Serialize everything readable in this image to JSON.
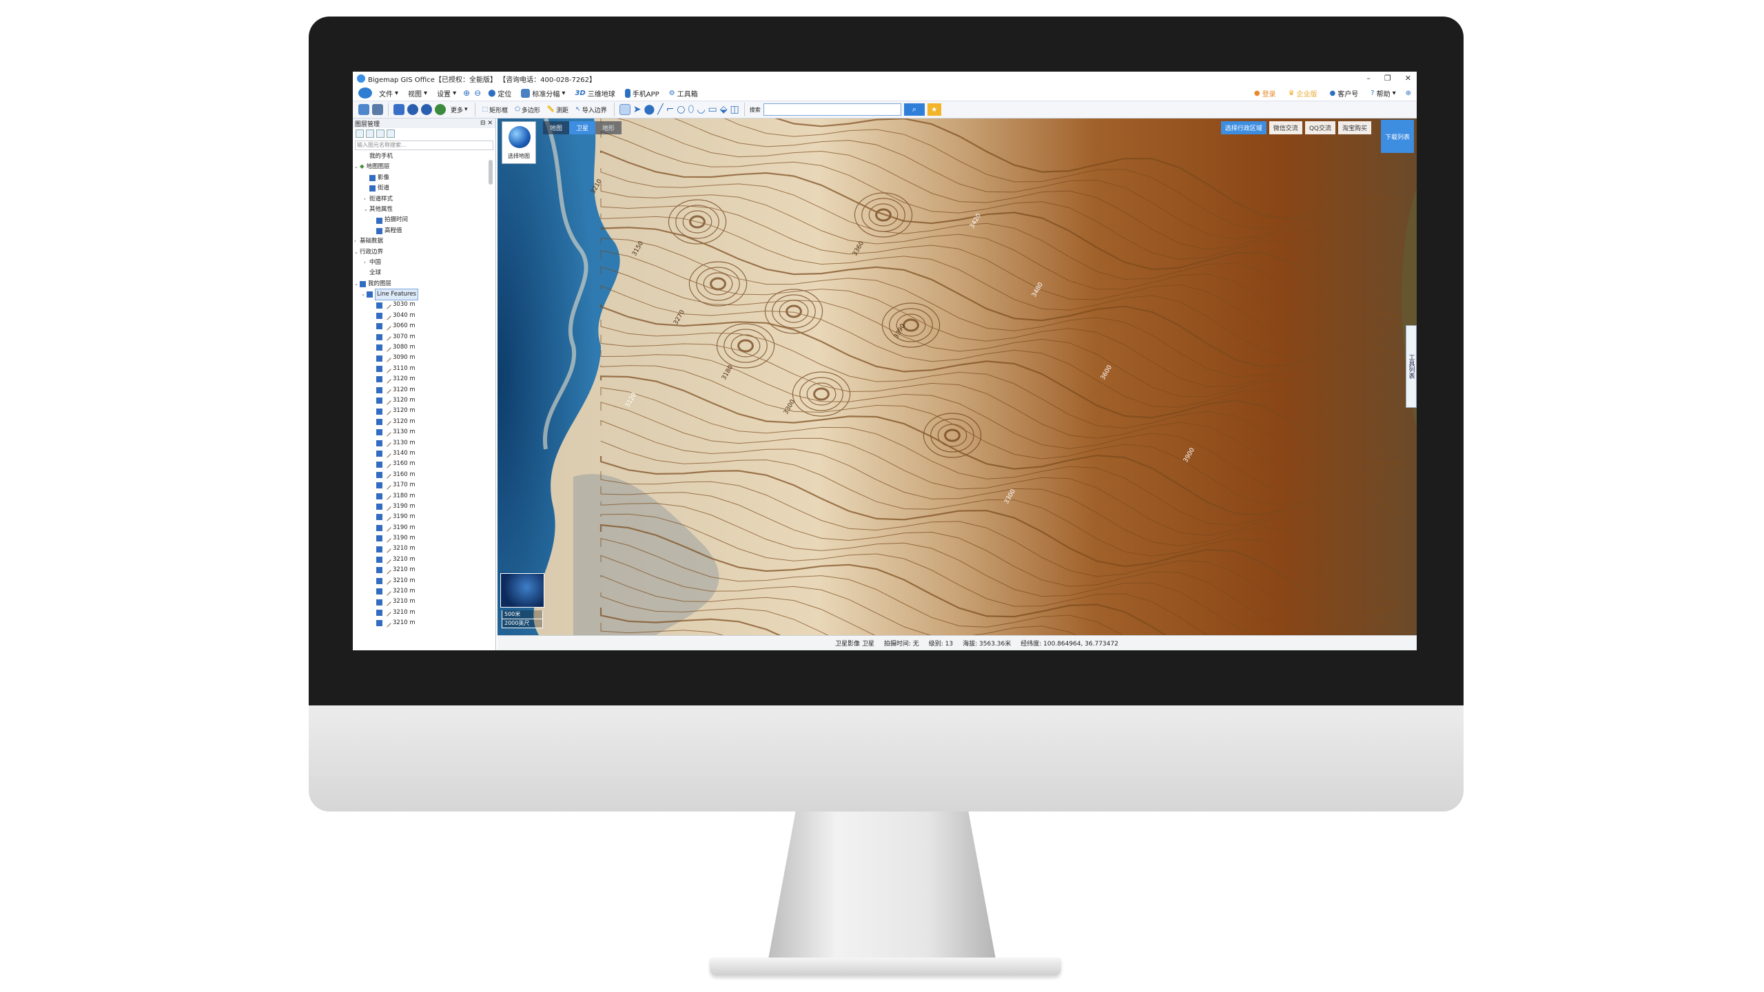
{
  "window": {
    "title": "Bigemap GIS Office【已授权：全能版】 【咨询电话：400-028-7262】"
  },
  "menubar": {
    "items": [
      "文件",
      "视图",
      "设置",
      "定位",
      "标准分幅",
      "三维地球",
      "手机APP",
      "工具箱"
    ],
    "three_d": "3D",
    "right": [
      "登录",
      "企业版",
      "客户号",
      "帮助"
    ]
  },
  "toolbar": {
    "more": "更多",
    "rect": "矩形框",
    "poly": "多边形",
    "measure": "测距",
    "import": "导入边界",
    "search_label": "搜索"
  },
  "panel": {
    "title": "图层管理",
    "search_placeholder": "输入图元名称搜索...",
    "tree": {
      "my_phone": "我的手机",
      "map_layers": "地图图层",
      "imagery": "影像",
      "roads": "街道",
      "style": "街道样式",
      "other_props": "其他属性",
      "capture_time": "拍摄时间",
      "elevation": "高程值",
      "basic_data": "基础数据",
      "admin": "行政边界",
      "china": "中国",
      "global": "全球",
      "my_layers": "我的图层",
      "line_features": "Line Features",
      "contours": [
        "3030 m",
        "3040 m",
        "3060 m",
        "3070 m",
        "3080 m",
        "3090 m",
        "3110 m",
        "3120 m",
        "3120 m",
        "3120 m",
        "3120 m",
        "3120 m",
        "3130 m",
        "3130 m",
        "3140 m",
        "3160 m",
        "3160 m",
        "3170 m",
        "3180 m",
        "3190 m",
        "3190 m",
        "3190 m",
        "3190 m",
        "3210 m",
        "3210 m",
        "3210 m",
        "3210 m",
        "3210 m",
        "3210 m",
        "3210 m",
        "3210 m"
      ]
    }
  },
  "map": {
    "tabs": [
      "地图",
      "卫星",
      "地形"
    ],
    "choose_map": "选择地图",
    "select_admin": "选择行政区域",
    "wechat": "微信交流",
    "qq": "QQ交流",
    "taobao": "淘宝购买",
    "download_list": "下载列表",
    "tool_list": "工具列表",
    "scale_m": "500米",
    "scale_ft": "2000英尺",
    "contour_labels": [
      "3210",
      "3150",
      "3270",
      "3180",
      "3300",
      "3360",
      "3390",
      "3420",
      "3480",
      "3600",
      "3900",
      "3300",
      "3120"
    ]
  },
  "status": {
    "layer": "卫星影像 卫星",
    "capture": "拍摄时间: 无",
    "level": "级别:  13",
    "altitude": "海拔: 3563.36米",
    "coords": "经纬度:  100.864964, 36.773472"
  },
  "colors": {
    "accent": "#3d8de0",
    "contour": "#7a4a1c",
    "terrain_dark": "#8b4a1a"
  }
}
